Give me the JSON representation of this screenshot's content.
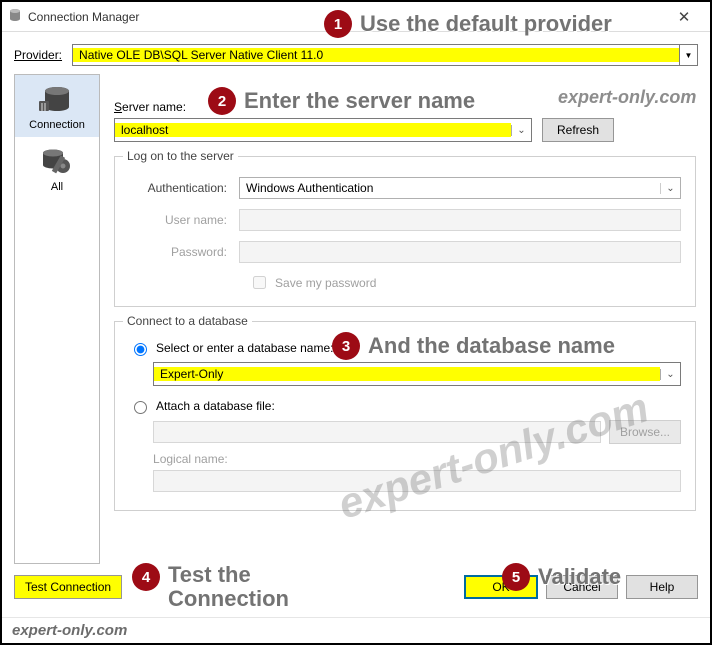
{
  "window": {
    "title": "Connection Manager",
    "close": "✕"
  },
  "provider": {
    "label": "Provider:",
    "value": "Native OLE DB\\SQL Server Native Client 11.0"
  },
  "sideTabs": {
    "connection": "Connection",
    "all": "All"
  },
  "server": {
    "label": "Server name:",
    "underline": "S",
    "value": "localhost",
    "refresh": "Refresh",
    "refresh_ul": "R"
  },
  "logon": {
    "legend": "Log on to the server",
    "auth_label": "Authentication:",
    "auth_ul": "A",
    "auth_value": "Windows Authentication",
    "user_label": "User name:",
    "user_ul": "U",
    "pass_label": "Password:",
    "pass_ul": "P",
    "save_label": "Save my password",
    "save_ul": "S"
  },
  "db": {
    "legend": "Connect to a database",
    "select_label": "Select or enter a database name:",
    "select_ul": "d",
    "value": "Expert-Only",
    "attach_label": "Attach a database file:",
    "attach_ul": "h",
    "browse": "Browse...",
    "logical_label": "Logical name:",
    "logical_ul": "L"
  },
  "buttons": {
    "test": "Test Connection",
    "test_ul": "T",
    "ok": "OK",
    "cancel": "Cancel",
    "help": "Help"
  },
  "callouts": {
    "c1": "Use the default provider",
    "c2": "Enter the server name",
    "c3": "And the database name",
    "c4a": "Test the",
    "c4b": "Connection",
    "c5": "Validate"
  },
  "watermark": "expert-only.com",
  "footer": "expert-only.com"
}
